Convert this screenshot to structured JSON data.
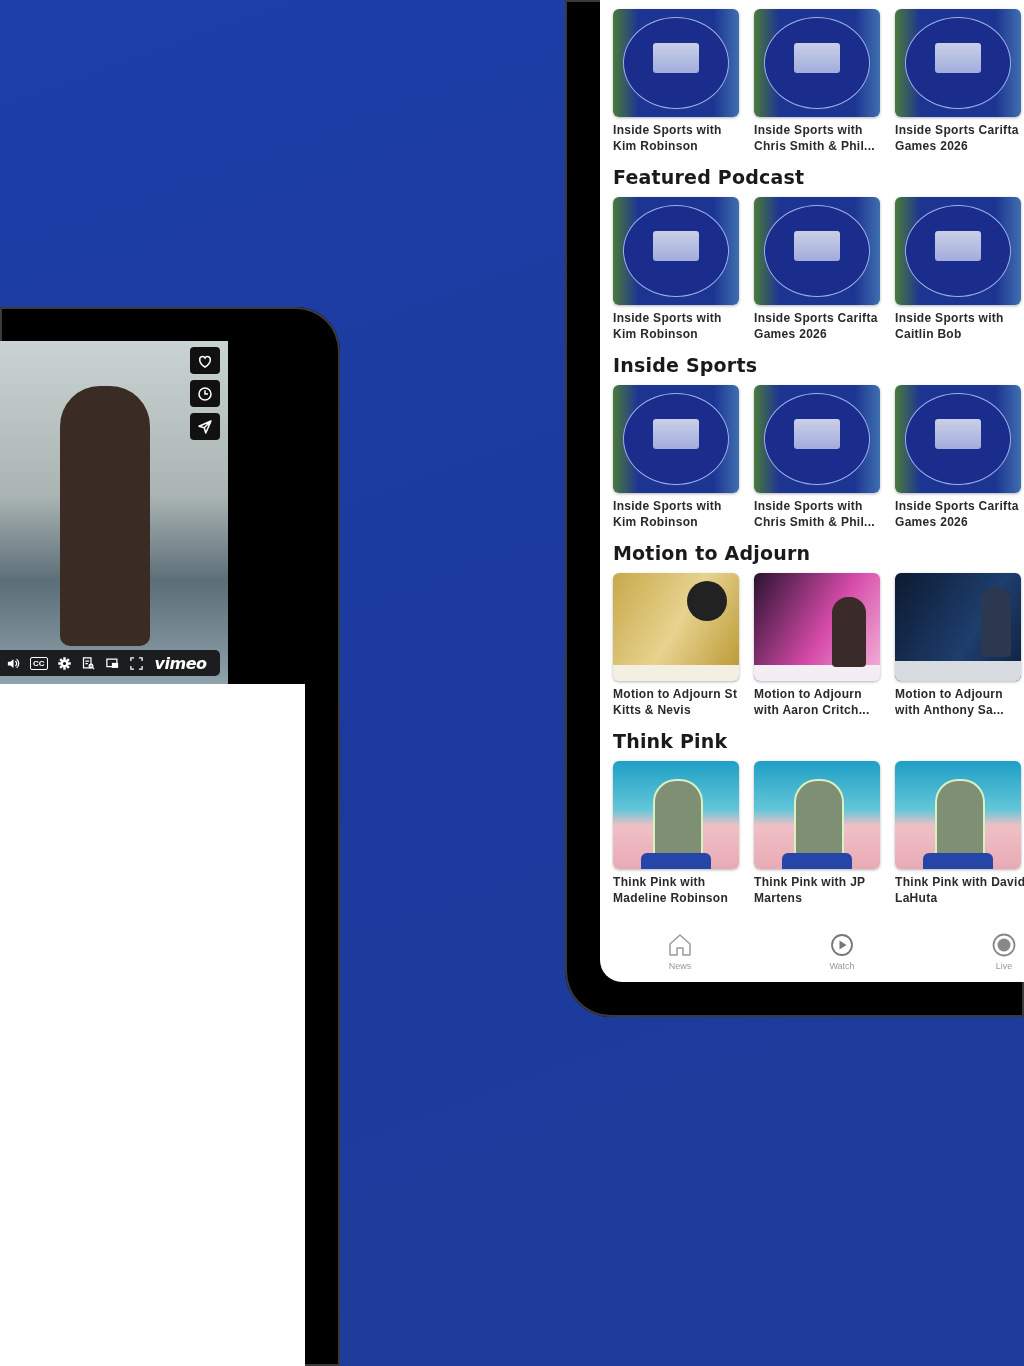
{
  "video_tablet": {
    "player": {
      "captions_label": "CC",
      "brand": "vimeo"
    }
  },
  "app_tablet": {
    "sections": [
      {
        "items": [
          {
            "title": "Inside Sports with Kim Robinson",
            "kind": "sports"
          },
          {
            "title": "Inside Sports with Chris Smith & Phil...",
            "kind": "sports"
          },
          {
            "title": "Inside Sports Carifta Games 2026",
            "kind": "sports"
          }
        ]
      },
      {
        "title": "Featured Podcast",
        "items": [
          {
            "title": "Inside Sports with Kim Robinson",
            "kind": "sports"
          },
          {
            "title": "Inside Sports Carifta Games 2026",
            "kind": "sports"
          },
          {
            "title": "Inside Sports with Caitlin Bob",
            "kind": "sports"
          }
        ]
      },
      {
        "title": "Inside Sports",
        "items": [
          {
            "title": "Inside Sports with Kim Robinson",
            "kind": "sports"
          },
          {
            "title": "Inside Sports with Chris Smith & Phil...",
            "kind": "sports"
          },
          {
            "title": "Inside Sports Carifta Games 2026",
            "kind": "sports"
          }
        ]
      },
      {
        "title": "Motion to Adjourn",
        "items": [
          {
            "title": "Motion to Adjourn St Kitts & Nevis",
            "kind": "gold-poster"
          },
          {
            "title": "Motion to Adjourn with Aaron Critch...",
            "kind": "pink-poster"
          },
          {
            "title": "Motion to Adjourn with Anthony Sa...",
            "kind": "dark-poster"
          }
        ]
      },
      {
        "title": "Think Pink",
        "items": [
          {
            "title": "Think Pink with Madeline Robinson",
            "kind": "beach-portrait"
          },
          {
            "title": "Think Pink with JP Martens",
            "kind": "beach-portrait"
          },
          {
            "title": "Think Pink with David LaHuta",
            "kind": "beach-portrait"
          }
        ]
      }
    ],
    "tab_bar": [
      {
        "label": "News",
        "kind": "home"
      },
      {
        "label": "Watch",
        "kind": "play"
      },
      {
        "label": "Live",
        "kind": "record"
      }
    ]
  }
}
